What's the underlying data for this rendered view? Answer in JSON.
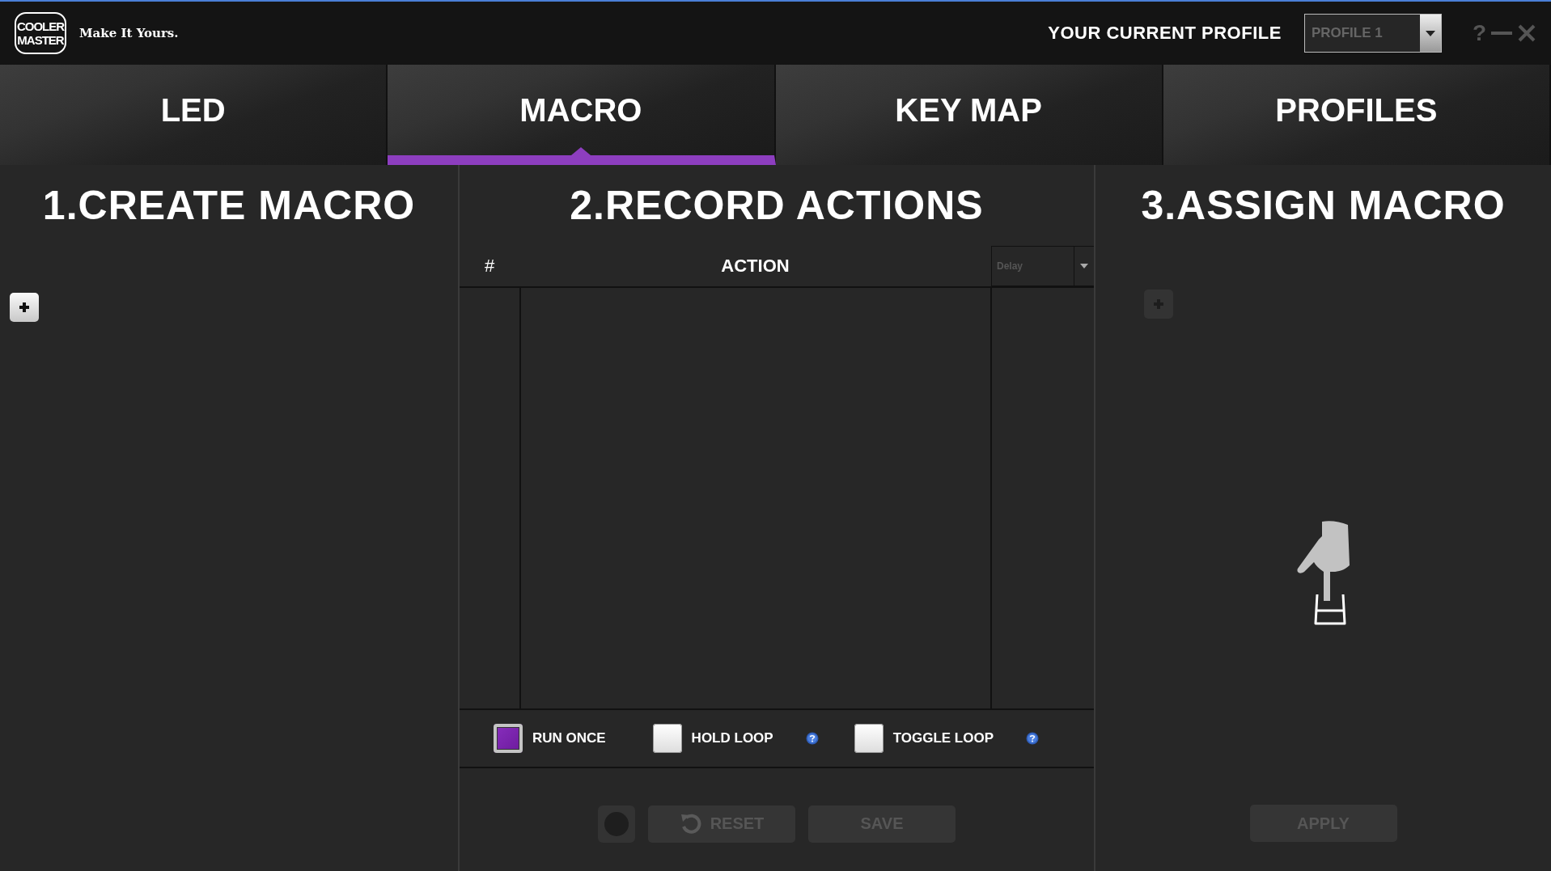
{
  "header": {
    "logo_lines": [
      "COOLER",
      "MASTER"
    ],
    "slogan": "Make It Yours.",
    "profile_label": "YOUR CURRENT PROFILE",
    "profile_select": {
      "value": "PROFILE 1"
    },
    "help": "?"
  },
  "tabs": [
    {
      "label": "LED",
      "selected": false
    },
    {
      "label": "MACRO",
      "selected": true
    },
    {
      "label": "KEY MAP",
      "selected": false
    },
    {
      "label": "PROFILES",
      "selected": false
    }
  ],
  "create_macro": {
    "title": "1.CREATE MACRO",
    "add_button": {
      "disabled": false
    }
  },
  "record_actions": {
    "title": "2.RECORD ACTIONS",
    "columns": [
      "#",
      "ACTION"
    ],
    "delay_select": {
      "value": "Delay"
    },
    "options": [
      {
        "label": "RUN ONCE",
        "checked": true,
        "help": false
      },
      {
        "label": "HOLD LOOP",
        "checked": false,
        "help": true
      },
      {
        "label": "TOGGLE LOOP",
        "checked": false,
        "help": true
      }
    ],
    "record_button": {
      "disabled": true
    },
    "buttons": [
      {
        "kind": "reset",
        "label": "RESET",
        "disabled": true
      },
      {
        "kind": "save",
        "label": "SAVE",
        "disabled": true
      }
    ]
  },
  "assign_macro": {
    "title": "3.ASSIGN MACRO",
    "add_button": {
      "disabled": true
    },
    "apply_button": {
      "label": "APPLY",
      "disabled": true
    }
  }
}
